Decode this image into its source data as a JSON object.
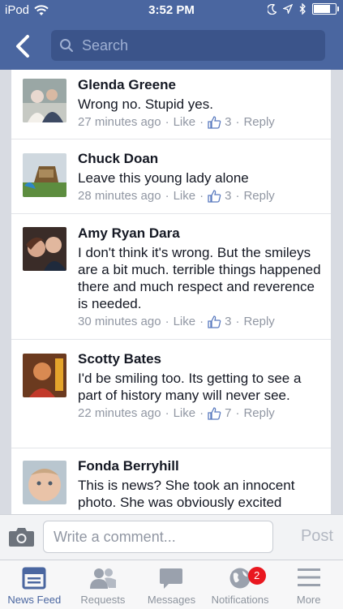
{
  "status_bar": {
    "carrier": "iPod",
    "time": "3:52 PM",
    "battery_level": 0.8
  },
  "nav": {
    "search_placeholder": "Search"
  },
  "comments": [
    {
      "name": "Glenda Greene",
      "text": "Wrong no.  Stupid yes.",
      "time": "27 minutes ago",
      "like_label": "Like",
      "likes": "3",
      "reply_label": "Reply"
    },
    {
      "name": "Chuck Doan",
      "text": "Leave this young lady alone",
      "time": "28 minutes ago",
      "like_label": "Like",
      "likes": "3",
      "reply_label": "Reply"
    },
    {
      "name": "Amy Ryan Dara",
      "text": "I don't think it's wrong. But the smileys are a bit much.  terrible things happened there and much respect and reverence is needed.",
      "time": "30 minutes ago",
      "like_label": "Like",
      "likes": "3",
      "reply_label": "Reply"
    },
    {
      "name": "Scotty Bates",
      "text": "I'd be smiling too. Its getting to see a part of history many will never see.",
      "time": "22 minutes ago",
      "like_label": "Like",
      "likes": "7",
      "reply_label": "Reply"
    },
    {
      "name": "Fonda Berryhill",
      "text": "This is news? She took an innocent photo. She was obviously excited",
      "time": "",
      "like_label": "",
      "likes": "",
      "reply_label": ""
    }
  ],
  "compose": {
    "placeholder": "Write a comment...",
    "post_label": "Post"
  },
  "tabs": [
    {
      "label": "News Feed",
      "icon": "news-feed-icon",
      "active": true
    },
    {
      "label": "Requests",
      "icon": "friend-requests-icon"
    },
    {
      "label": "Messages",
      "icon": "messages-icon"
    },
    {
      "label": "Notifications",
      "icon": "globe-icon",
      "badge": "2"
    },
    {
      "label": "More",
      "icon": "menu-icon"
    }
  ],
  "colors": {
    "brand": "#4a66a0",
    "badge": "#e9171f"
  }
}
